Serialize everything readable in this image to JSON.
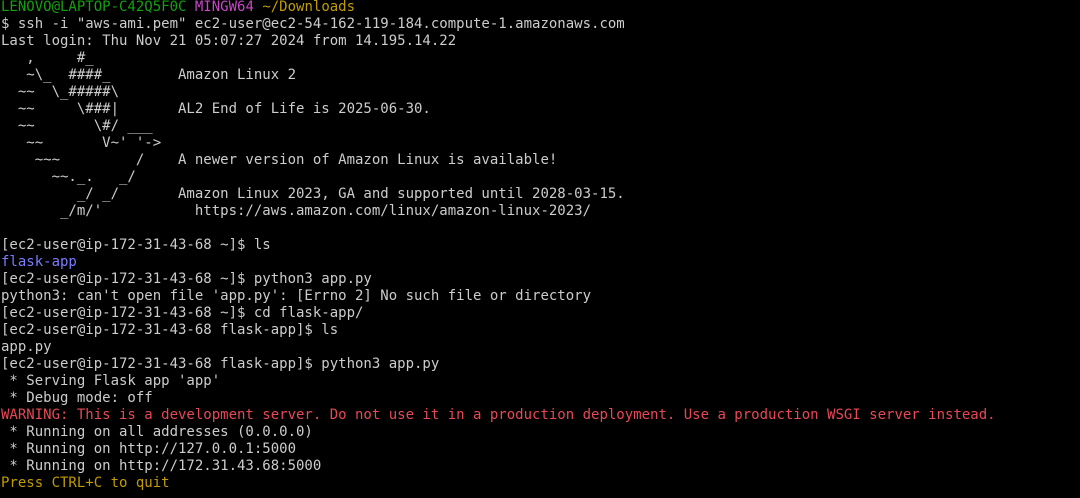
{
  "title_bar": {
    "user_host": "LENOVO@LAPTOP-C42Q5F0C",
    "shell": "MINGW64",
    "cwd": "~/Downloads"
  },
  "lines": {
    "ssh_cmd": "$ ssh -i \"aws-ami.pem\" ec2-user@ec2-54-162-119-184.compute-1.amazonaws.com",
    "last_login": "Last login: Thu Nov 21 05:07:27 2024 from 14.195.14.22",
    "motd_1": "   ,     #_",
    "motd_2": "   ~\\_  ####_        Amazon Linux 2",
    "motd_3": "  ~~  \\_#####\\",
    "motd_4": "  ~~     \\###|       AL2 End of Life is 2025-06-30.",
    "motd_5": "  ~~       \\#/ ___",
    "motd_6": "   ~~       V~' '->",
    "motd_7": "    ~~~         /    A newer version of Amazon Linux is available!",
    "motd_8": "      ~~._.   _/",
    "motd_9": "         _/ _/       Amazon Linux 2023, GA and supported until 2028-03-15.",
    "motd_10": "       _/m/'           https://aws.amazon.com/linux/amazon-linux-2023/",
    "blank": "",
    "cmd_ls_1": "[ec2-user@ip-172-31-43-68 ~]$ ls",
    "out_ls_1": "flask-app",
    "cmd_py_1": "[ec2-user@ip-172-31-43-68 ~]$ python3 app.py",
    "err_py_1": "python3: can't open file 'app.py': [Errno 2] No such file or directory",
    "cmd_cd": "[ec2-user@ip-172-31-43-68 ~]$ cd flask-app/",
    "cmd_ls_2": "[ec2-user@ip-172-31-43-68 flask-app]$ ls",
    "out_ls_2": "app.py",
    "cmd_py_2": "[ec2-user@ip-172-31-43-68 flask-app]$ python3 app.py",
    "flask_1": " * Serving Flask app 'app'",
    "flask_2": " * Debug mode: off",
    "warning": "WARNING: This is a development server. Do not use it in a production deployment. Use a production WSGI server instead.",
    "flask_3": " * Running on all addresses (0.0.0.0)",
    "flask_4": " * Running on http://127.0.0.1:5000",
    "flask_5": " * Running on http://172.31.43.68:5000",
    "quit": "Press CTRL+C to quit"
  },
  "colors": {
    "background": "#000000",
    "text": "#cccccc",
    "green": "#13a10e",
    "magenta": "#c847c8",
    "yellow": "#c19c00",
    "blue": "#7b7bff",
    "red": "#e74856"
  }
}
